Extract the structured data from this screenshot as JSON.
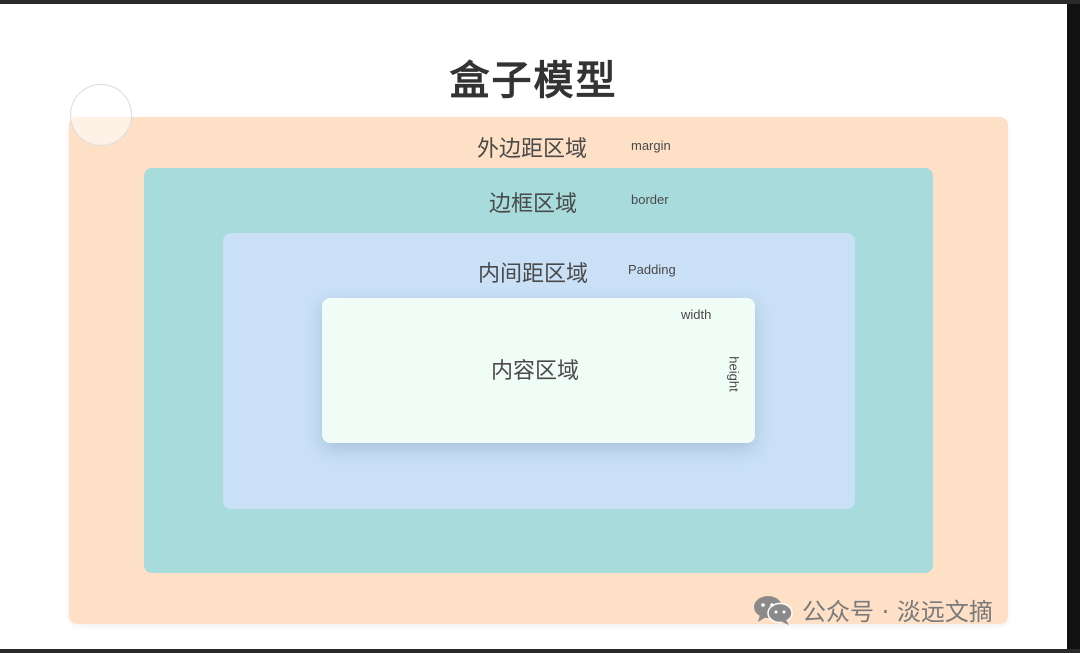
{
  "title": "盒子模型",
  "margin": {
    "label_cn": "外边距区域",
    "label_en": "margin"
  },
  "border": {
    "label_cn": "边框区域",
    "label_en": "border"
  },
  "padding": {
    "label_cn": "内间距区域",
    "label_en": "Padding"
  },
  "content": {
    "label_cn": "内容区域",
    "width_label": "width",
    "height_label": "height"
  },
  "watermark": {
    "icon": "wechat-icon",
    "text": "公众号 · 淡远文摘"
  },
  "colors": {
    "margin": "#fde0c5",
    "border": "#a8dbdc",
    "padding": "#c9e0f6",
    "content": "#f0fdf6"
  }
}
